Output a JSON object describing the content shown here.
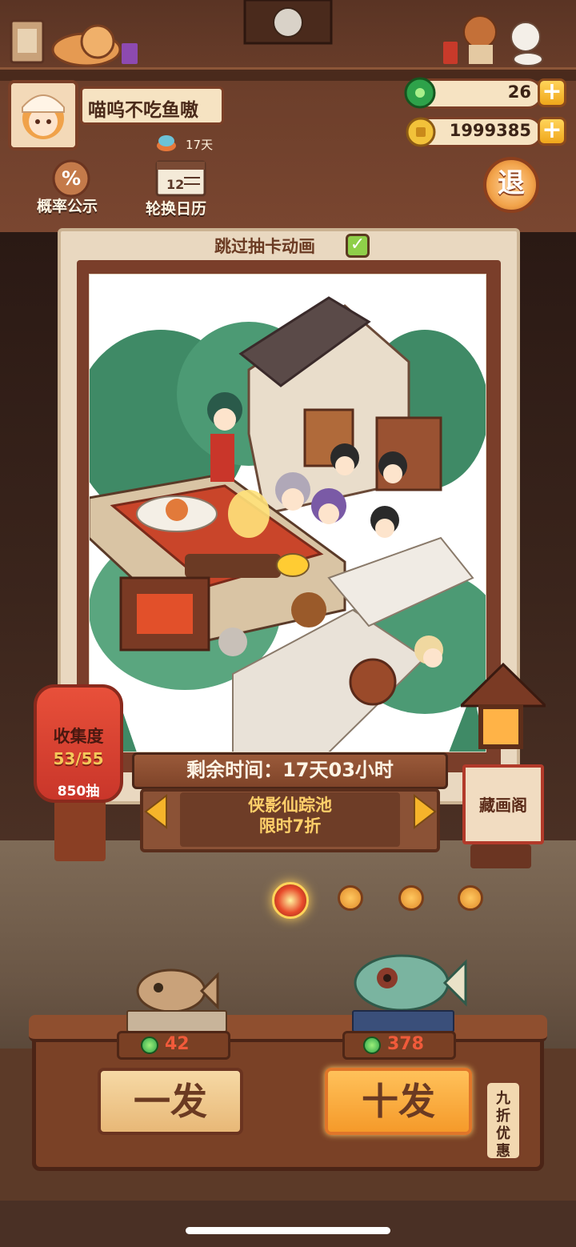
{
  "profile": {
    "name": "喵呜不吃鱼嗷",
    "days": "17天"
  },
  "currency": {
    "jade": "26",
    "coins": "1999385",
    "plus_symbol": "+"
  },
  "buttons": {
    "rate": "概率公示",
    "calendar": "轮换日历",
    "calendar_number": "12",
    "exit": "退",
    "rate_symbol": "%"
  },
  "card": {
    "skip_label": "跳过抽卡动画",
    "skip_checked": true
  },
  "collection": {
    "title": "收集度",
    "count": "53/55",
    "draws": "850抽"
  },
  "pool": {
    "timer": "剩余时间：17天03小时",
    "name": "侠影仙踪池",
    "discount": "限时7折"
  },
  "gallery": {
    "label": "藏画阁"
  },
  "pagination": {
    "total": 4,
    "active": 0
  },
  "draw": {
    "single_label": "一发",
    "single_cost": "42",
    "ten_label": "十发",
    "ten_cost": "378",
    "discount_tag": "九折优惠"
  },
  "colors": {
    "accent_orange": "#f59a2a",
    "jade_green": "#2ea24a",
    "price_red": "#f05a3a",
    "wood_brown": "#7a4126"
  }
}
